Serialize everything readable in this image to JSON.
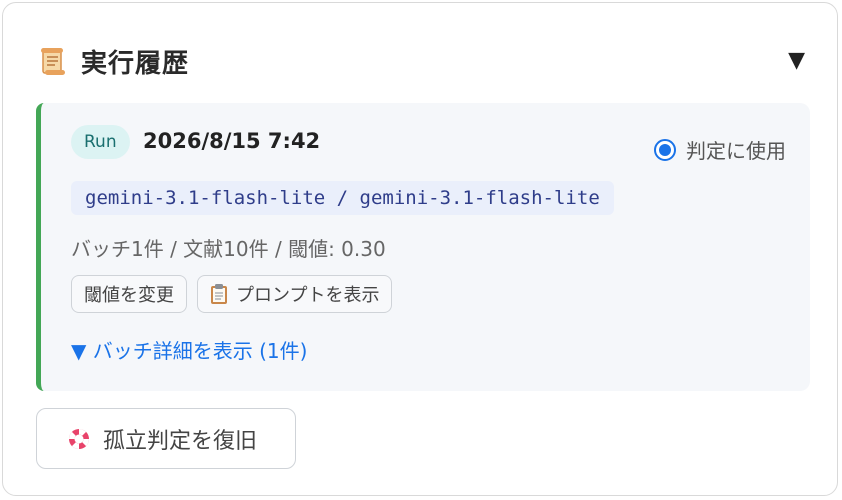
{
  "header": {
    "title": "実行履歴",
    "title_icon": "scroll-icon",
    "toggle_glyph": "▼"
  },
  "run": {
    "badge": "Run",
    "timestamp": "2026/8/15 7:42",
    "use_for_judgement_label": "判定に使用",
    "use_for_judgement_selected": true,
    "model": "gemini-3.1-flash-lite / gemini-3.1-flash-lite",
    "meta": "バッチ1件 / 文献10件 / 閾値: 0.30",
    "buttons": {
      "change_threshold": "閾値を変更",
      "show_prompt": "プロンプトを表示"
    },
    "batch_details_link": "▼ バッチ詳細を表示 (1件)",
    "accent_color": "#43a756"
  },
  "restore_button": {
    "label": "孤立判定を復旧",
    "icon": "lifebuoy-icon"
  }
}
